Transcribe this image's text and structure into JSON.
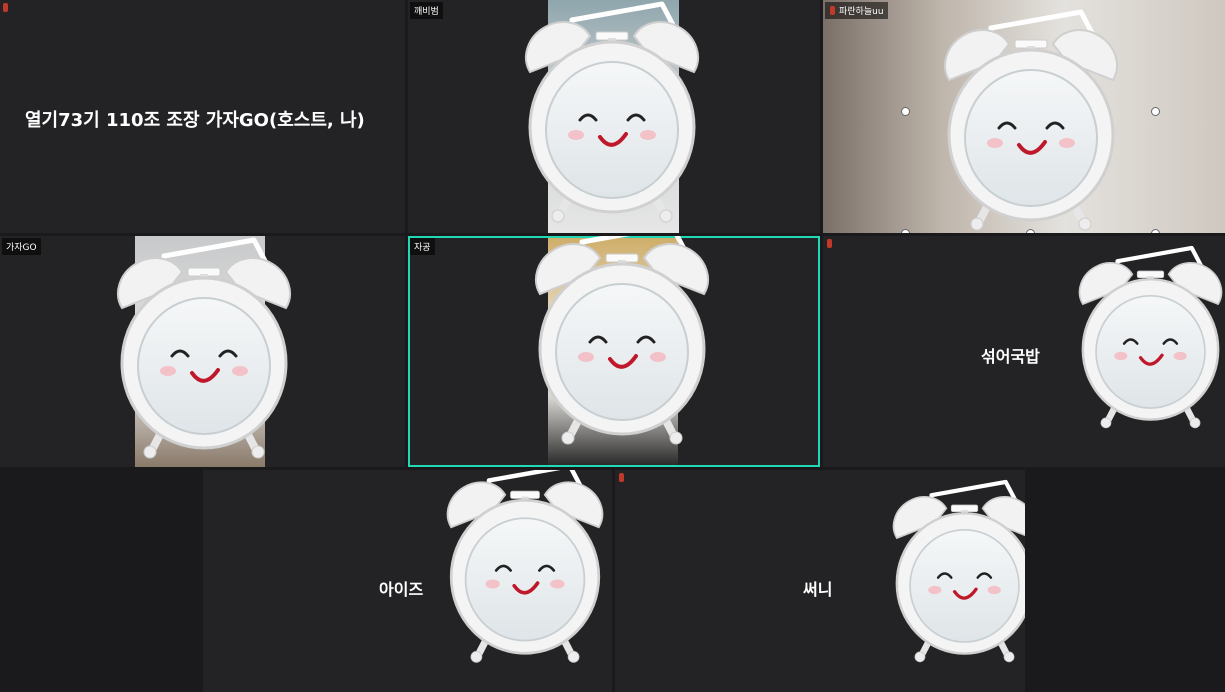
{
  "participants": [
    {
      "name": "열기73기 110조 조장 가자GO(호스트, 나)"
    },
    {
      "tag": "깨비범"
    },
    {
      "tag": "파란하늘uu"
    },
    {
      "tag": "가자GO"
    },
    {
      "tag": "자공"
    },
    {
      "name": "섞어국밥"
    },
    {
      "name": "아이즈"
    },
    {
      "name": "써니"
    }
  ],
  "colors": {
    "active_border": "#23d9b5",
    "tile_bg": "#232325",
    "mic_muted": "#c0392b"
  }
}
